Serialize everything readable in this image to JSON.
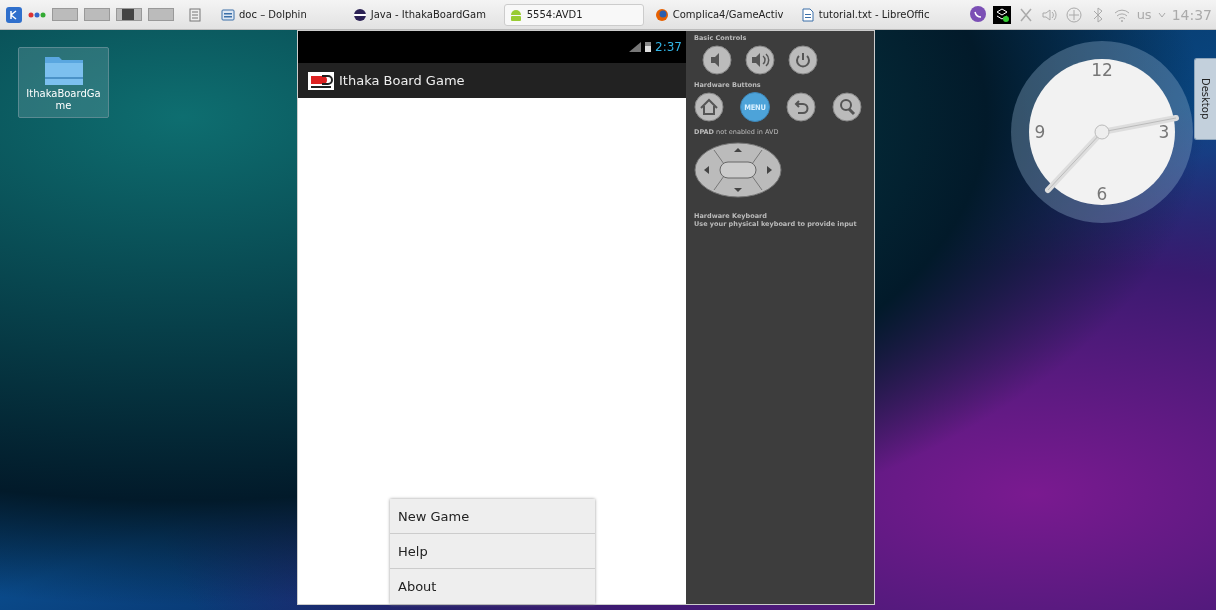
{
  "taskbar": {
    "pager": [
      {
        "selected": false
      },
      {
        "selected": false
      },
      {
        "selected": true
      },
      {
        "selected": false
      }
    ],
    "tasks": [
      {
        "kind": "files",
        "label": "doc – Dolphin",
        "selected": false
      },
      {
        "kind": "eclipse",
        "label": "Java - IthakaBoardGam",
        "selected": false
      },
      {
        "kind": "android",
        "label": "5554:AVD1",
        "selected": true
      },
      {
        "kind": "firefox",
        "label": "Complica4/GameActiv",
        "selected": false
      },
      {
        "kind": "document",
        "label": "tutorial.txt - LibreOffic",
        "selected": false
      }
    ],
    "keyboard_layout": "us",
    "clock": "14:37"
  },
  "desktop": {
    "icons": [
      {
        "label": "IthakaBoardGame",
        "selected": true
      }
    ],
    "side_tab": "Desktop",
    "clock_widget": {
      "numerals": [
        "12",
        "3",
        "6",
        "9"
      ]
    }
  },
  "emulator": {
    "phone": {
      "status_time": "2:37",
      "app_title": "Ithaka Board Game",
      "menu": [
        {
          "label": "New Game"
        },
        {
          "label": "Help"
        },
        {
          "label": "About"
        }
      ]
    },
    "controls": {
      "basic_heading": "Basic Controls",
      "basic_buttons": [
        {
          "kind": "volume-down"
        },
        {
          "kind": "volume-up"
        },
        {
          "kind": "power"
        }
      ],
      "hardware_heading": "Hardware Buttons",
      "hardware_buttons": [
        {
          "kind": "home"
        },
        {
          "kind": "menu",
          "label": "MENU"
        },
        {
          "kind": "back"
        },
        {
          "kind": "search"
        }
      ],
      "dpad_note": "**DPAD** not enabled in AVD",
      "keyboard_heading": "Hardware Keyboard",
      "keyboard_note": "Use your physical keyboard to provide input"
    }
  }
}
